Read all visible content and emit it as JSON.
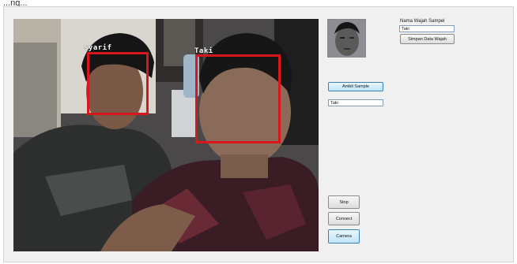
{
  "window_title_fragment": "...ng...",
  "camera": {
    "faces": [
      {
        "label": "syarif"
      },
      {
        "label": "Taki"
      }
    ]
  },
  "sample_name_label": "Nama Wajah Sampel",
  "sample_name_value": "Taki",
  "save_face_button": "Simpan Data Wajah",
  "take_sample_button": "Ambil Sample",
  "recognized_name_value": "Taki",
  "buttons": {
    "stop": "Stop",
    "connect": "Connect",
    "camera": "Camera"
  },
  "colors": {
    "face_box": "#d8161b",
    "window_bg": "#f0f0f0"
  }
}
